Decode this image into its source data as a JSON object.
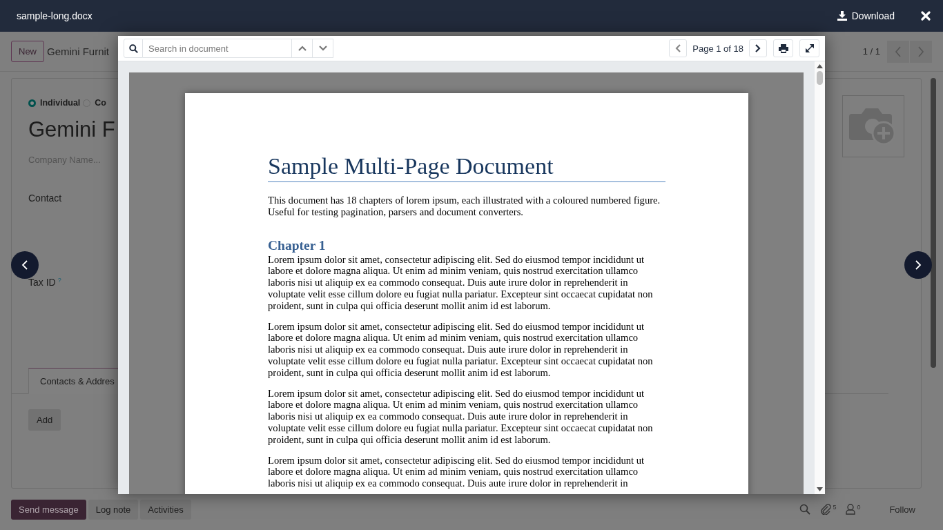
{
  "viewer": {
    "file_name": "sample-long.docx",
    "download_label": "Download",
    "search_placeholder": "Search in document",
    "page_label": "Page 1 of 18"
  },
  "document": {
    "title": "Sample Multi-Page Document",
    "intro": "This document has 18 chapters of lorem ipsum, each illustrated with a coloured numbered figure. Useful for testing pagination, parsers and document converters.",
    "sections": [
      {
        "heading": "Chapter 1",
        "paragraphs": [
          "Lorem ipsum dolor sit amet, consectetur adipiscing elit. Sed do eiusmod tempor incididunt ut labore et dolore magna aliqua. Ut enim ad minim veniam, quis nostrud exercitation ullamco laboris nisi ut aliquip ex ea commodo consequat. Duis aute irure dolor in reprehenderit in voluptate velit esse cillum dolore eu fugiat nulla pariatur. Excepteur sint occaecat cupidatat non proident, sunt in culpa qui officia deserunt mollit anim id est laborum.",
          "Lorem ipsum dolor sit amet, consectetur adipiscing elit. Sed do eiusmod tempor incididunt ut labore et dolore magna aliqua. Ut enim ad minim veniam, quis nostrud exercitation ullamco laboris nisi ut aliquip ex ea commodo consequat. Duis aute irure dolor in reprehenderit in voluptate velit esse cillum dolore eu fugiat nulla pariatur. Excepteur sint occaecat cupidatat non proident, sunt in culpa qui officia deserunt mollit anim id est laborum.",
          "Lorem ipsum dolor sit amet, consectetur adipiscing elit. Sed do eiusmod tempor incididunt ut labore et dolore magna aliqua. Ut enim ad minim veniam, quis nostrud exercitation ullamco laboris nisi ut aliquip ex ea commodo consequat. Duis aute irure dolor in reprehenderit in voluptate velit esse cillum dolore eu fugiat nulla pariatur. Excepteur sint occaecat cupidatat non proident, sunt in culpa qui officia deserunt mollit anim id est laborum.",
          "Lorem ipsum dolor sit amet, consectetur adipiscing elit. Sed do eiusmod tempor incididunt ut labore et dolore magna aliqua. Ut enim ad minim veniam, quis nostrud exercitation ullamco laboris nisi ut aliquip ex ea commodo consequat. Duis aute irure dolor in reprehenderit in"
        ]
      }
    ]
  },
  "form": {
    "new_label": "New",
    "breadcrumb": "Gemini Furnit",
    "pager": "1 / 1",
    "company_types": [
      {
        "label": "Individual",
        "selected": true
      },
      {
        "label": "Co",
        "selected": false
      }
    ],
    "name": "Gemini F",
    "company_placeholder": "Company Name...",
    "fields": [
      {
        "label": "Contact"
      },
      {
        "label": "Tax ID",
        "help": "?"
      }
    ],
    "tabs": [
      {
        "label": "Contacts & Addres",
        "selected": true
      }
    ],
    "add_label": "Add"
  },
  "chatter": {
    "buttons": [
      {
        "label": "Send message",
        "kind": "primary"
      },
      {
        "label": "Log note",
        "kind": "secondary"
      },
      {
        "label": "Activities",
        "kind": "secondary"
      }
    ],
    "attachments_count": "5",
    "followers_count": "0",
    "follow_label": "Follow"
  }
}
